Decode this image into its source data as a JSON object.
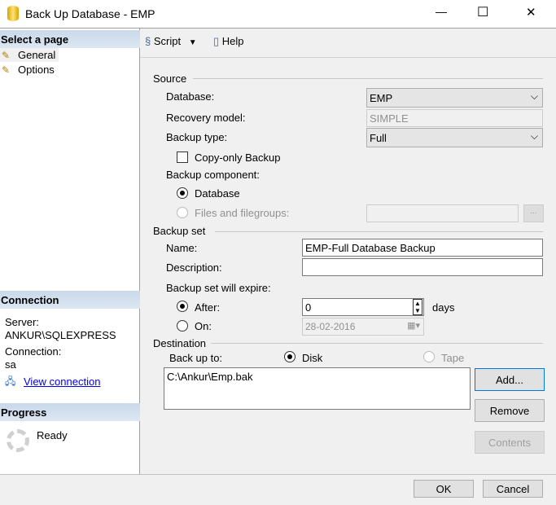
{
  "window": {
    "title": "Back Up Database - EMP",
    "minimize": "—",
    "maximize": "☐",
    "close": "✕"
  },
  "sidebar": {
    "select_header": "Select a page",
    "pages": [
      {
        "label": "General"
      },
      {
        "label": "Options"
      }
    ],
    "connection_header": "Connection",
    "server_label": "Server:",
    "server_value": "ANKUR\\SQLEXPRESS",
    "connection_label": "Connection:",
    "connection_value": "sa",
    "view_connection": "View connection",
    "progress_header": "Progress",
    "progress_status": "Ready"
  },
  "toolbar": {
    "script": "Script",
    "help": "Help"
  },
  "source": {
    "title": "Source",
    "database_label": "Database:",
    "database_value": "EMP",
    "recovery_label": "Recovery model:",
    "recovery_value": "SIMPLE",
    "backup_type_label": "Backup type:",
    "backup_type_value": "Full",
    "copy_only": "Copy-only Backup",
    "component_label": "Backup component:",
    "component_database": "Database",
    "component_files": "Files and filegroups:",
    "browse": "..."
  },
  "backup_set": {
    "title": "Backup set",
    "name_label": "Name:",
    "name_value": "EMP-Full Database Backup",
    "description_label": "Description:",
    "description_value": "",
    "expire_label": "Backup set will expire:",
    "after_label": "After:",
    "after_value": "0",
    "days": "days",
    "on_label": "On:",
    "on_value": "28-02-2016"
  },
  "destination": {
    "title": "Destination",
    "backup_to_label": "Back up to:",
    "disk": "Disk",
    "tape": "Tape",
    "paths": [
      "C:\\Ankur\\Emp.bak"
    ],
    "add": "Add...",
    "remove": "Remove",
    "contents": "Contents"
  },
  "footer": {
    "ok": "OK",
    "cancel": "Cancel"
  }
}
